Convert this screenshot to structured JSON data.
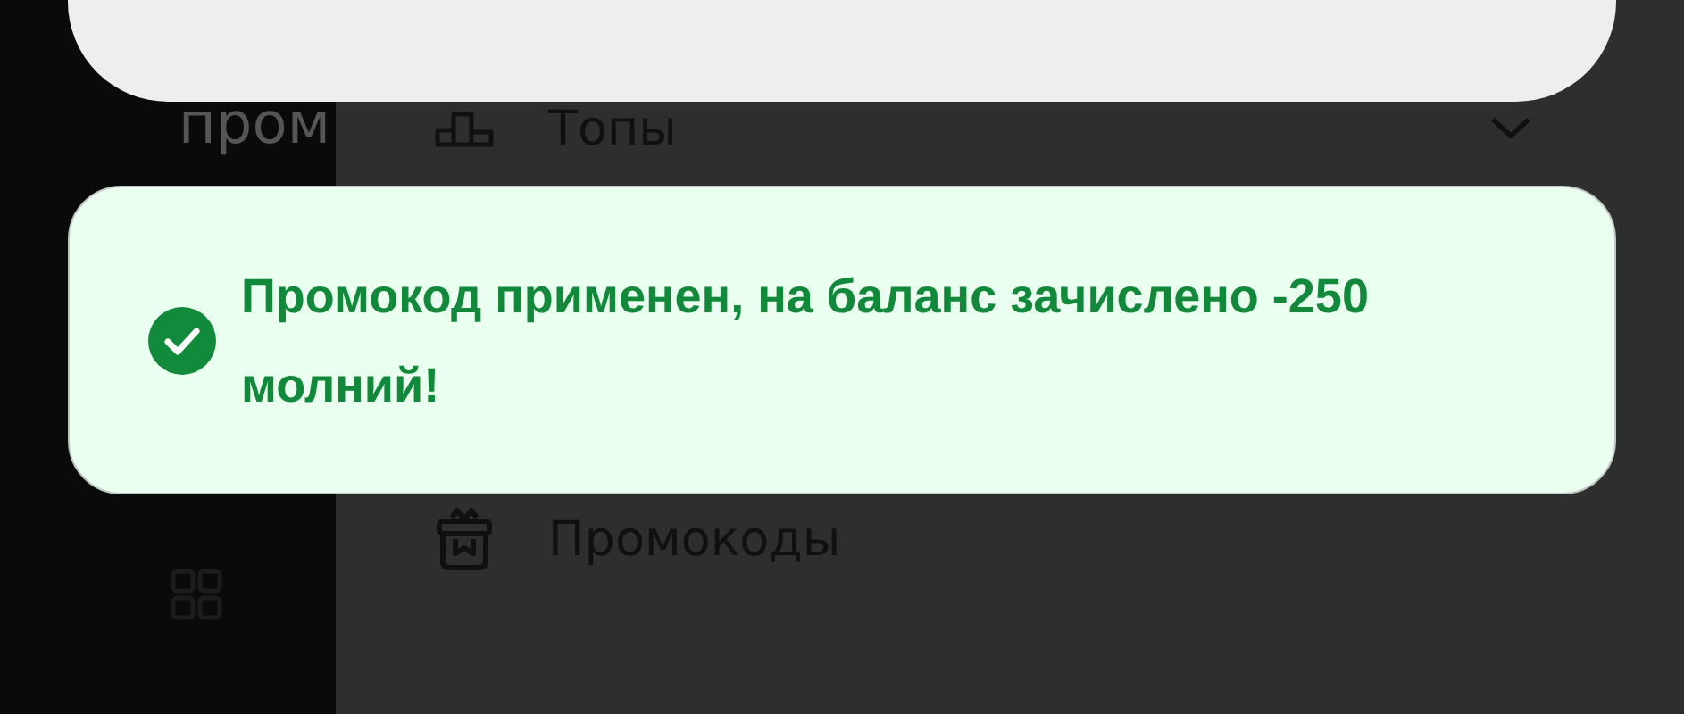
{
  "sidebar": {
    "label": "пром"
  },
  "menu": [
    {
      "kind": "tops",
      "label": "Топы",
      "expandable": true
    },
    {
      "kind": "promo",
      "label": "Промокоды",
      "expandable": false
    }
  ],
  "toast": {
    "kind": "success",
    "message": "Промокод применен, на баланс зачислено -250 молний!"
  }
}
